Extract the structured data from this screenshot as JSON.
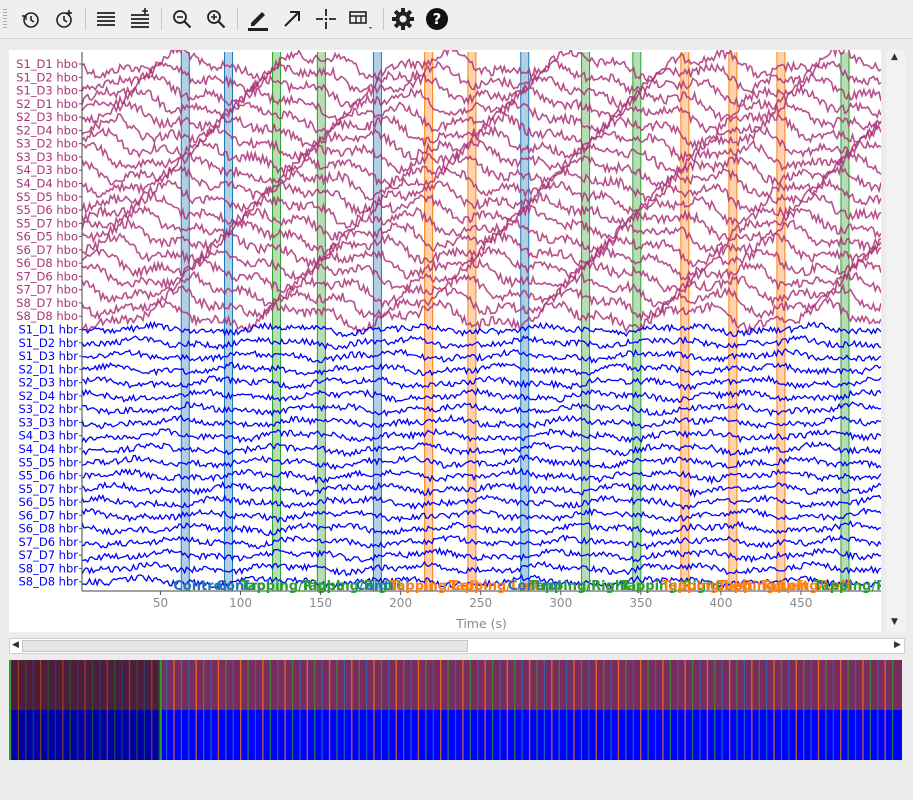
{
  "toolbar": {
    "icons": [
      "history-back-icon",
      "history-add-icon",
      "channels-fewer-icon",
      "channels-more-icon",
      "zoom-out-icon",
      "zoom-in-icon",
      "annotation-pen-icon",
      "projector-arrow-icon",
      "crosshair-icon",
      "overview-bar-icon",
      "settings-gear-icon",
      "help-icon"
    ]
  },
  "chart_data": {
    "type": "line",
    "title": "",
    "xlabel": "Time (s)",
    "ylabel": "",
    "xlim": [
      1,
      500
    ],
    "xticks": [
      50,
      100,
      150,
      200,
      250,
      300,
      350,
      400,
      450
    ],
    "grid": false,
    "channels": [
      "S1_D1 hbo",
      "S1_D2 hbo",
      "S1_D3 hbo",
      "S2_D1 hbo",
      "S2_D3 hbo",
      "S2_D4 hbo",
      "S3_D2 hbo",
      "S3_D3 hbo",
      "S4_D3 hbo",
      "S4_D4 hbo",
      "S5_D5 hbo",
      "S5_D6 hbo",
      "S5_D7 hbo",
      "S6_D5 hbo",
      "S6_D7 hbo",
      "S6_D8 hbo",
      "S7_D6 hbo",
      "S7_D7 hbo",
      "S8_D7 hbo",
      "S8_D8 hbo",
      "S1_D1 hbr",
      "S1_D2 hbr",
      "S1_D3 hbr",
      "S2_D1 hbr",
      "S2_D3 hbr",
      "S2_D4 hbr",
      "S3_D2 hbr",
      "S3_D3 hbr",
      "S4_D3 hbr",
      "S4_D4 hbr",
      "S5_D5 hbr",
      "S5_D6 hbr",
      "S5_D7 hbr",
      "S6_D5 hbr",
      "S6_D7 hbr",
      "S6_D8 hbr",
      "S7_D6 hbr",
      "S7_D7 hbr",
      "S8_D7 hbr",
      "S8_D8 hbr"
    ],
    "channel_colors": {
      "hbo": "#aa3377",
      "hbr": "#0000ff"
    },
    "annotation_colors": {
      "Control": "#1f77b4",
      "Tapping/Left": "#ff7f0e",
      "Tapping/Right": "#2ca02c"
    },
    "annotations": [
      {
        "onset": 63,
        "duration": 5,
        "description": "Control"
      },
      {
        "onset": 90,
        "duration": 5,
        "description": "Control"
      },
      {
        "onset": 120,
        "duration": 5,
        "description": "Tapping/Right"
      },
      {
        "onset": 148,
        "duration": 5,
        "description": "Tapping/Right"
      },
      {
        "onset": 183,
        "duration": 5,
        "description": "Control"
      },
      {
        "onset": 215,
        "duration": 5,
        "description": "Tapping/Left"
      },
      {
        "onset": 242,
        "duration": 5,
        "description": "Tapping/Left"
      },
      {
        "onset": 275,
        "duration": 5,
        "description": "Control"
      },
      {
        "onset": 313,
        "duration": 5,
        "description": "Tapping/Right"
      },
      {
        "onset": 345,
        "duration": 5,
        "description": "Tapping/Right"
      },
      {
        "onset": 375,
        "duration": 5,
        "description": "Tapping/Left"
      },
      {
        "onset": 405,
        "duration": 5,
        "description": "Tapping/Left"
      },
      {
        "onset": 435,
        "duration": 5,
        "description": "Tapping/Left"
      },
      {
        "onset": 475,
        "duration": 5,
        "description": "Tapping/Right"
      }
    ],
    "annotation_labels_visible": [
      {
        "x": 58,
        "text": "Control",
        "description": "Control"
      },
      {
        "x": 85,
        "text": "Control",
        "description": "Control"
      },
      {
        "x": 100,
        "text": "Tapping/Right",
        "description": "Tapping/Right"
      },
      {
        "x": 138,
        "text": "Tapping/Right",
        "description": "Tapping/Right"
      },
      {
        "x": 172,
        "text": "Control",
        "description": "Control"
      },
      {
        "x": 193,
        "text": "Tapping/Left",
        "description": "Tapping/Left"
      },
      {
        "x": 230,
        "text": "Tapping/Left",
        "description": "Tapping/Left"
      },
      {
        "x": 267,
        "text": "Control",
        "description": "Control"
      },
      {
        "x": 280,
        "text": "Tapping/Right",
        "description": "Tapping/Right"
      },
      {
        "x": 337,
        "text": "Tapping/Right",
        "description": "Tapping/Right"
      },
      {
        "x": 363,
        "text": "Tapping/Left",
        "description": "Tapping/Left"
      },
      {
        "x": 398,
        "text": "Tapping/Left",
        "description": "Tapping/Left"
      },
      {
        "x": 425,
        "text": "Tapping/Left",
        "description": "Tapping/Left"
      },
      {
        "x": 458,
        "text": "Tapping/Right",
        "description": "Tapping/Right"
      }
    ]
  },
  "overview": {
    "bands": [
      {
        "name": "hbo",
        "color": "#7a2c5e"
      },
      {
        "name": "hbr",
        "color": "#0000ff"
      }
    ],
    "viewport_fraction": 0.17,
    "marker_count": 120
  }
}
